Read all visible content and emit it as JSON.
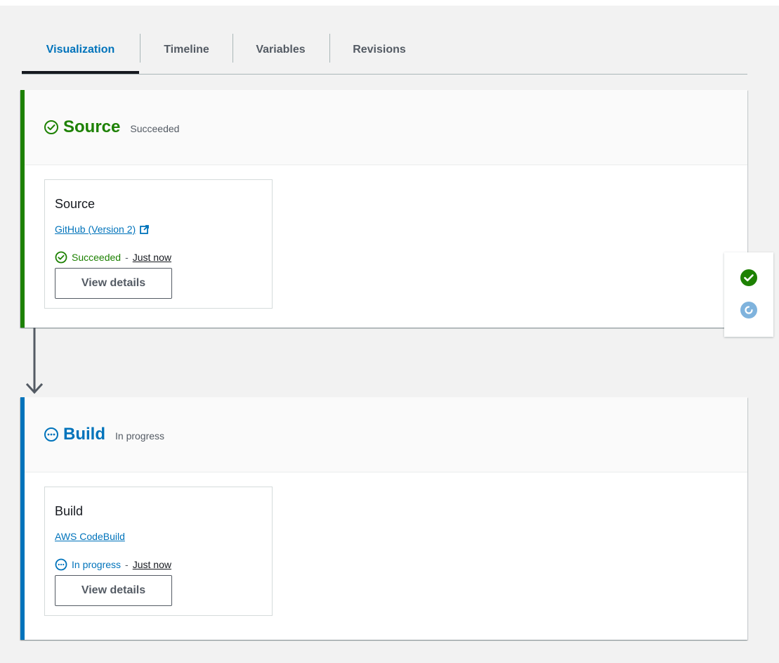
{
  "tabs": [
    {
      "label": "Visualization",
      "active": true
    },
    {
      "label": "Timeline",
      "active": false
    },
    {
      "label": "Variables",
      "active": false
    },
    {
      "label": "Revisions",
      "active": false
    }
  ],
  "colors": {
    "succeeded": "#1d8102",
    "in_progress": "#0073bb",
    "active_tab": "#0073bb"
  },
  "stages": {
    "source": {
      "name": "Source",
      "status": "Succeeded",
      "icon": "check-circle-outline-icon",
      "action": {
        "name": "Source",
        "provider": "GitHub (Version 2)",
        "provider_icon": "external-link-icon",
        "status": "Succeeded",
        "separator": "-",
        "time": "Just now",
        "button": "View details"
      }
    },
    "build": {
      "name": "Build",
      "status": "In progress",
      "icon": "ellipsis-circle-icon",
      "action": {
        "name": "Build",
        "provider": "AWS CodeBuild",
        "status": "In progress",
        "separator": "-",
        "time": "Just now",
        "button": "View details"
      }
    }
  },
  "side_panel": {
    "icons": [
      "check-circle-filled-icon",
      "refresh-circle-icon"
    ]
  }
}
